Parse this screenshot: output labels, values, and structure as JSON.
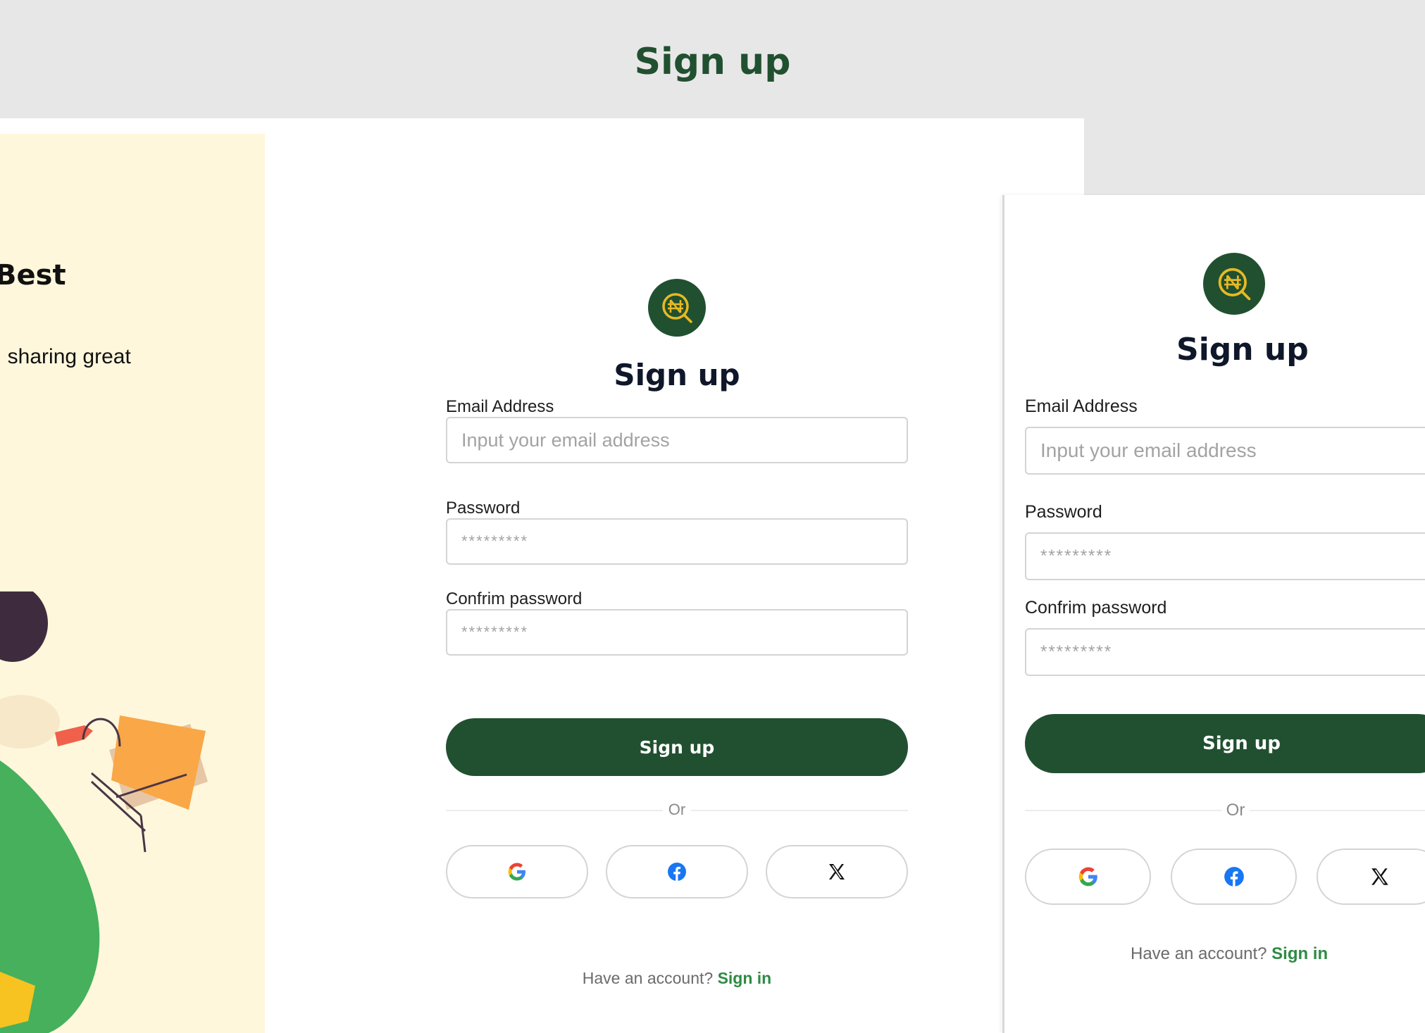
{
  "page_title": "Sign up",
  "promo": {
    "title": "e Best",
    "subtitle": ", sharing great"
  },
  "form": {
    "title": "Sign up",
    "email_label": "Email Address",
    "email_placeholder": "Input your email address",
    "password_label": "Password",
    "password_value": "*********",
    "confirm_label": "Confrim password",
    "confirm_value": "*********",
    "submit_label": "Sign up",
    "divider_text": "Or",
    "footer_text": "Have an account?",
    "footer_link": "Sign in"
  },
  "social": [
    "google-icon",
    "facebook-icon",
    "x-icon"
  ],
  "colors": {
    "brand_green": "#215030",
    "link_green": "#2e8b44",
    "logo_gold": "#e8b923",
    "promo_bg": "#fef7dc",
    "page_bg": "#e8e7e8"
  }
}
